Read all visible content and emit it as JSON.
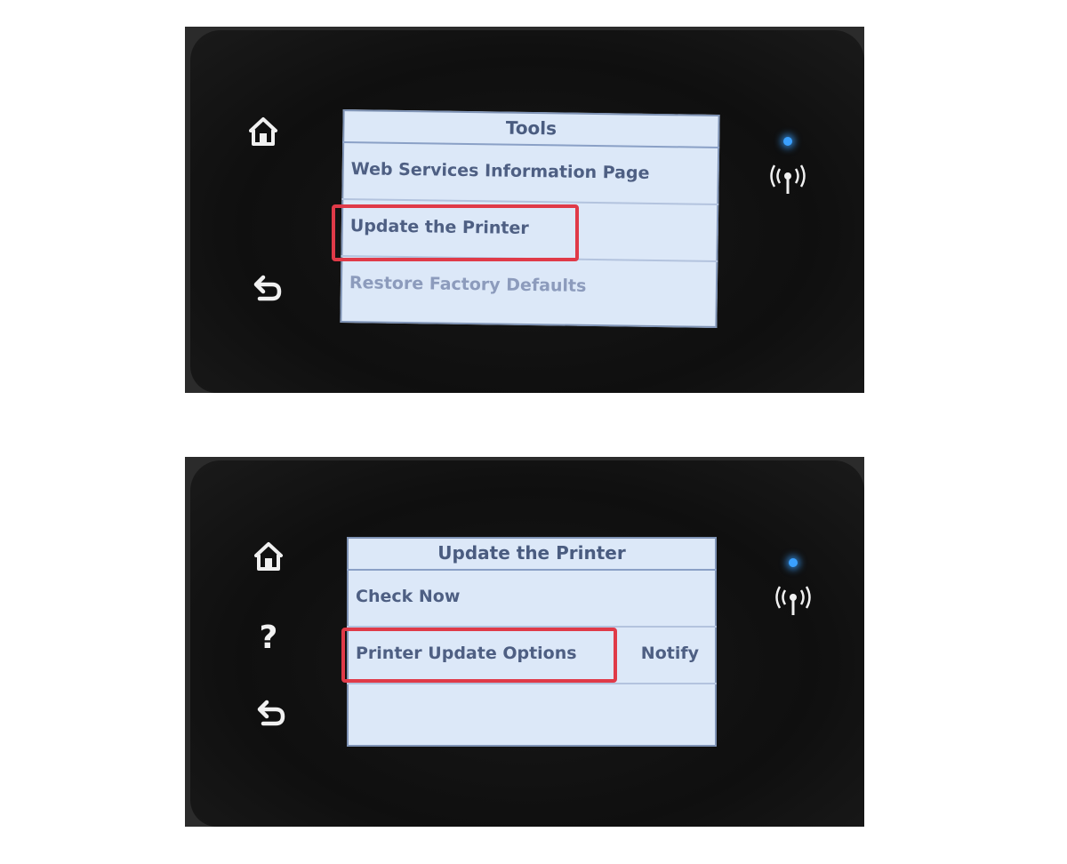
{
  "screen1": {
    "title": "Tools",
    "items": [
      {
        "label": "Web Services Information Page"
      },
      {
        "label": "Update the Printer"
      },
      {
        "label": "Restore Factory Defaults"
      }
    ]
  },
  "screen2": {
    "title": "Update the Printer",
    "items": [
      {
        "label": "Check Now",
        "value": ""
      },
      {
        "label": "Printer Update Options",
        "value": "Notify"
      },
      {
        "label": "",
        "value": ""
      }
    ]
  },
  "panel_buttons": {
    "home_icon": "home-icon",
    "help_symbol": "?",
    "back_icon": "back-icon",
    "wireless_icon": "wireless-icon"
  },
  "colors": {
    "highlight": "#e03a48",
    "led": "#3aa0ff",
    "screen_bg": "#dce8f8"
  }
}
